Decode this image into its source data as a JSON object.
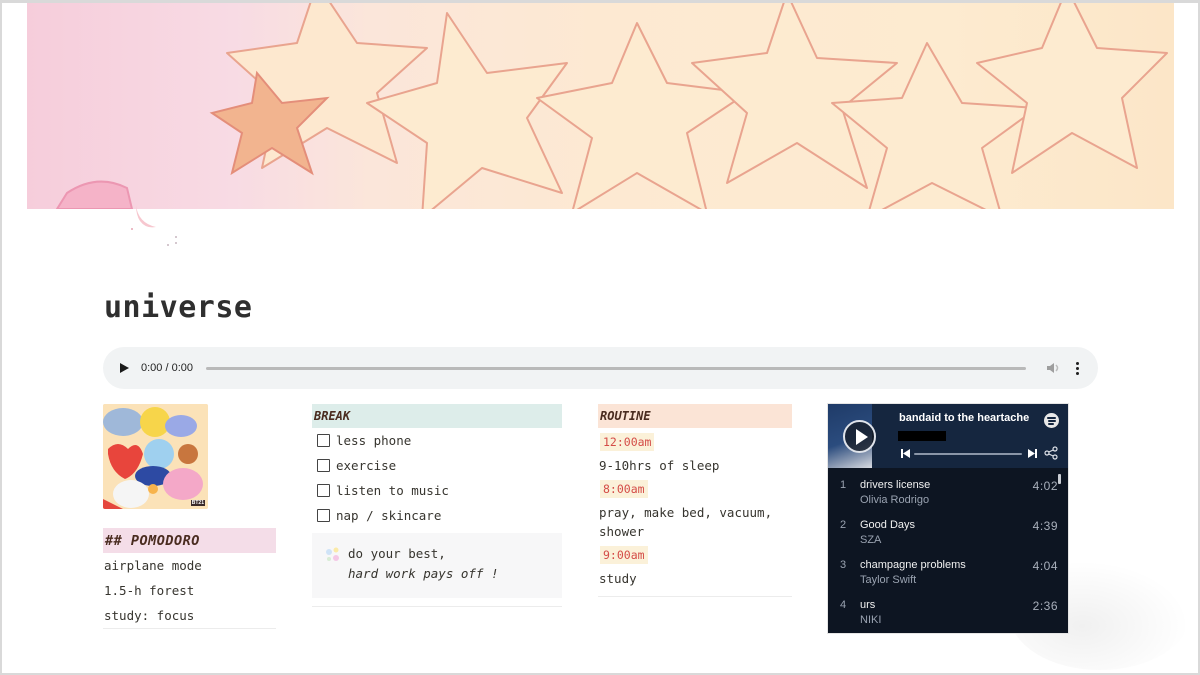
{
  "page": {
    "title": "universe"
  },
  "audio_player": {
    "time": "0:00 / 0:00"
  },
  "pomodoro": {
    "header": "## POMODORO",
    "album_badge": "BT21",
    "lines": [
      "airplane mode",
      "1.5-h forest",
      "study: focus"
    ]
  },
  "break": {
    "header": "BREAK",
    "todos": [
      {
        "label": "less phone",
        "checked": false
      },
      {
        "label": "exercise",
        "checked": false
      },
      {
        "label": "listen to music",
        "checked": false
      },
      {
        "label": "nap / skincare",
        "checked": false
      }
    ],
    "callout": {
      "line1": "do your best,",
      "line2": "hard work pays off !"
    }
  },
  "routine": {
    "header": "ROUTINE",
    "entries": [
      {
        "time": "12:00am",
        "text": "9-10hrs of sleep"
      },
      {
        "time": "8:00am",
        "text": "pray, make bed, vacuum, shower"
      },
      {
        "time": "9:00am",
        "text": "study"
      }
    ]
  },
  "spotify": {
    "playlist_title": "bandaid to the heartache",
    "tracks": [
      {
        "num": "1",
        "name": "drivers license",
        "artist": "Olivia Rodrigo",
        "duration": "4:02"
      },
      {
        "num": "2",
        "name": "Good Days",
        "artist": "SZA",
        "duration": "4:39"
      },
      {
        "num": "3",
        "name": "champagne problems",
        "artist": "Taylor Swift",
        "duration": "4:04"
      },
      {
        "num": "4",
        "name": "urs",
        "artist": "NIKI",
        "duration": "2:36"
      }
    ]
  },
  "colors": {
    "pomodoro_header_bg": "#f4dde8",
    "break_header_bg": "#ddedea",
    "routine_header_bg": "#fbe4d6",
    "time_badge_text": "#d44c47",
    "time_badge_bg": "#fbf1d9",
    "spotify_bg": "#0d1522"
  }
}
